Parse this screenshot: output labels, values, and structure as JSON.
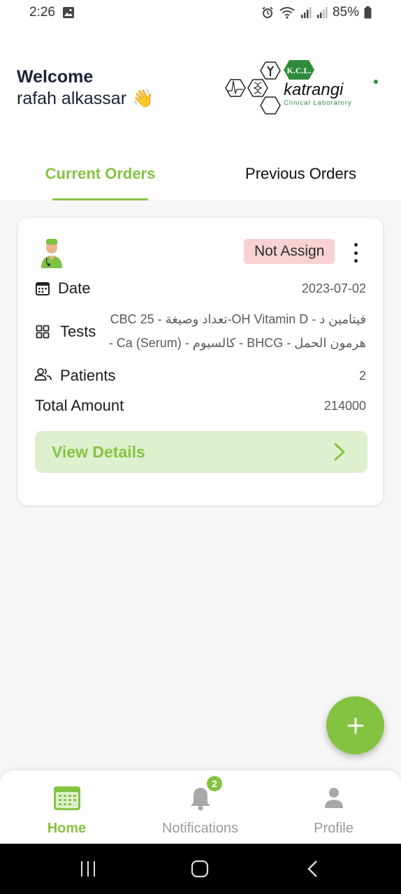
{
  "status_bar": {
    "time": "2:26",
    "battery": "85%"
  },
  "header": {
    "welcome": "Welcome",
    "user_name": "rafah alkassar",
    "wave_emoji": "👋",
    "logo": {
      "badge": "K.C.L.",
      "brand": "katrangi",
      "subtitle": "Clinical Laboratory"
    }
  },
  "tabs": [
    {
      "label": "Current Orders",
      "active": true
    },
    {
      "label": "Previous Orders",
      "active": false
    }
  ],
  "order": {
    "status": "Not Assign",
    "date_label": "Date",
    "date_value": "2023-07-02",
    "tests_label": "Tests",
    "tests_line1": "فيتامين د - OH Vitamin D-تعداد وصيغة - CBC 25",
    "tests_line2": "هرمون الحمل - BHCG - كالسيوم - Ca (Serum) -",
    "patients_label": "Patients",
    "patients_value": "2",
    "total_label": "Total Amount",
    "total_value": "214000",
    "view_details": "View Details"
  },
  "bottom_nav": [
    {
      "label": "Home",
      "icon": "calendar-icon",
      "active": true
    },
    {
      "label": "Notifications",
      "icon": "bell-icon",
      "active": false,
      "badge": "2"
    },
    {
      "label": "Profile",
      "icon": "person-icon",
      "active": false
    }
  ],
  "colors": {
    "accent": "#84c341",
    "status_badge": "#f8d2d2",
    "view_button_bg": "#dff0cf"
  }
}
